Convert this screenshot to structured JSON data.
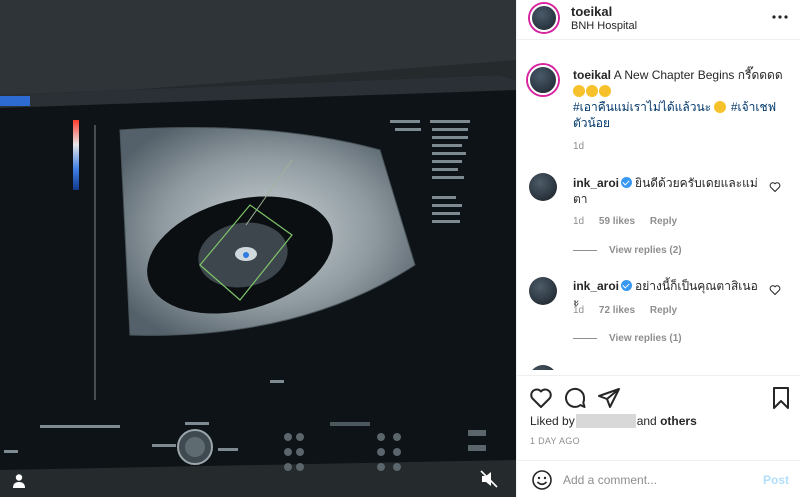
{
  "post": {
    "username": "toeikal",
    "location": "BNH Hospital"
  },
  "caption": {
    "username": "toeikal",
    "text": "A New Chapter Begins กรี๊ดดดด",
    "hashtag1": "#เอาคืนแม่เราไม่ได้แล้วนะ",
    "hashtag2": "#เจ้าเชฟตัวน้อย",
    "time": "1d"
  },
  "comments": [
    {
      "username": "ink_aroi",
      "text": "ยินดีด้วยครับเดยและแม่ตา",
      "time": "1d",
      "likes": "59 likes",
      "reply": "Reply",
      "view_replies": "View replies (2)"
    },
    {
      "username": "ink_aroi",
      "text": "อย่างนี้ก็เป็นคุณตาสิเนอะ",
      "time": "1d",
      "likes": "72 likes",
      "reply": "Reply",
      "view_replies": "View replies (1)"
    }
  ],
  "likes_bar": {
    "prefix": "Liked by",
    "middle": "and",
    "others": "others"
  },
  "date_label": "1 DAY AGO",
  "comment_box": {
    "placeholder": "Add a comment...",
    "post_label": "Post"
  },
  "icons": [
    "more-icon",
    "heart-icon",
    "comment-icon",
    "share-icon",
    "save-icon",
    "smile-icon",
    "mute-icon",
    "user-tag-icon"
  ],
  "colors": {
    "link": "#00376b",
    "muted": "#8e8e8e",
    "verified": "#3897f0",
    "post_disabled": "#b2dffc"
  }
}
